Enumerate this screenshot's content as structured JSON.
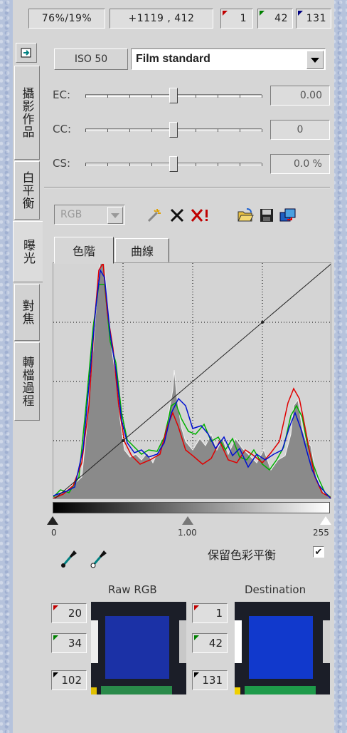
{
  "readout": {
    "zoom": "76%/19%",
    "coords": "+1119 , 412",
    "r": "1",
    "g": "42",
    "b": "131"
  },
  "side_tabs": [
    "攝影作品",
    "白平衡",
    "曝光",
    "對焦",
    "轉檔過程"
  ],
  "iso": "ISO 50",
  "film_mode": "Film standard",
  "sliders": [
    {
      "label": "EC:",
      "value": "0.00",
      "level": 0.5
    },
    {
      "label": "CC:",
      "value": "0",
      "level": 0.5
    },
    {
      "label": "CS:",
      "value": "0.0 %",
      "level": 0.5
    }
  ],
  "channel": "RGB",
  "tabs": {
    "levels": "色階",
    "curves": "曲線"
  },
  "scale": {
    "min": "0",
    "mid": "1.00",
    "max": "255"
  },
  "preserve_balance": "保留色彩平衡",
  "preserve_checked": true,
  "raw_rgb": {
    "title": "Raw RGB",
    "r": "20",
    "g": "34",
    "b": "102"
  },
  "destination": {
    "title": "Destination",
    "r": "1",
    "g": "42",
    "b": "131"
  },
  "colors": {
    "panel": "#d6d6d6",
    "red": "#e00000",
    "green": "#00b000",
    "blue": "#0010d0",
    "swatch_blue": "#1b31a6",
    "swatch_dest": "#1139cc"
  }
}
